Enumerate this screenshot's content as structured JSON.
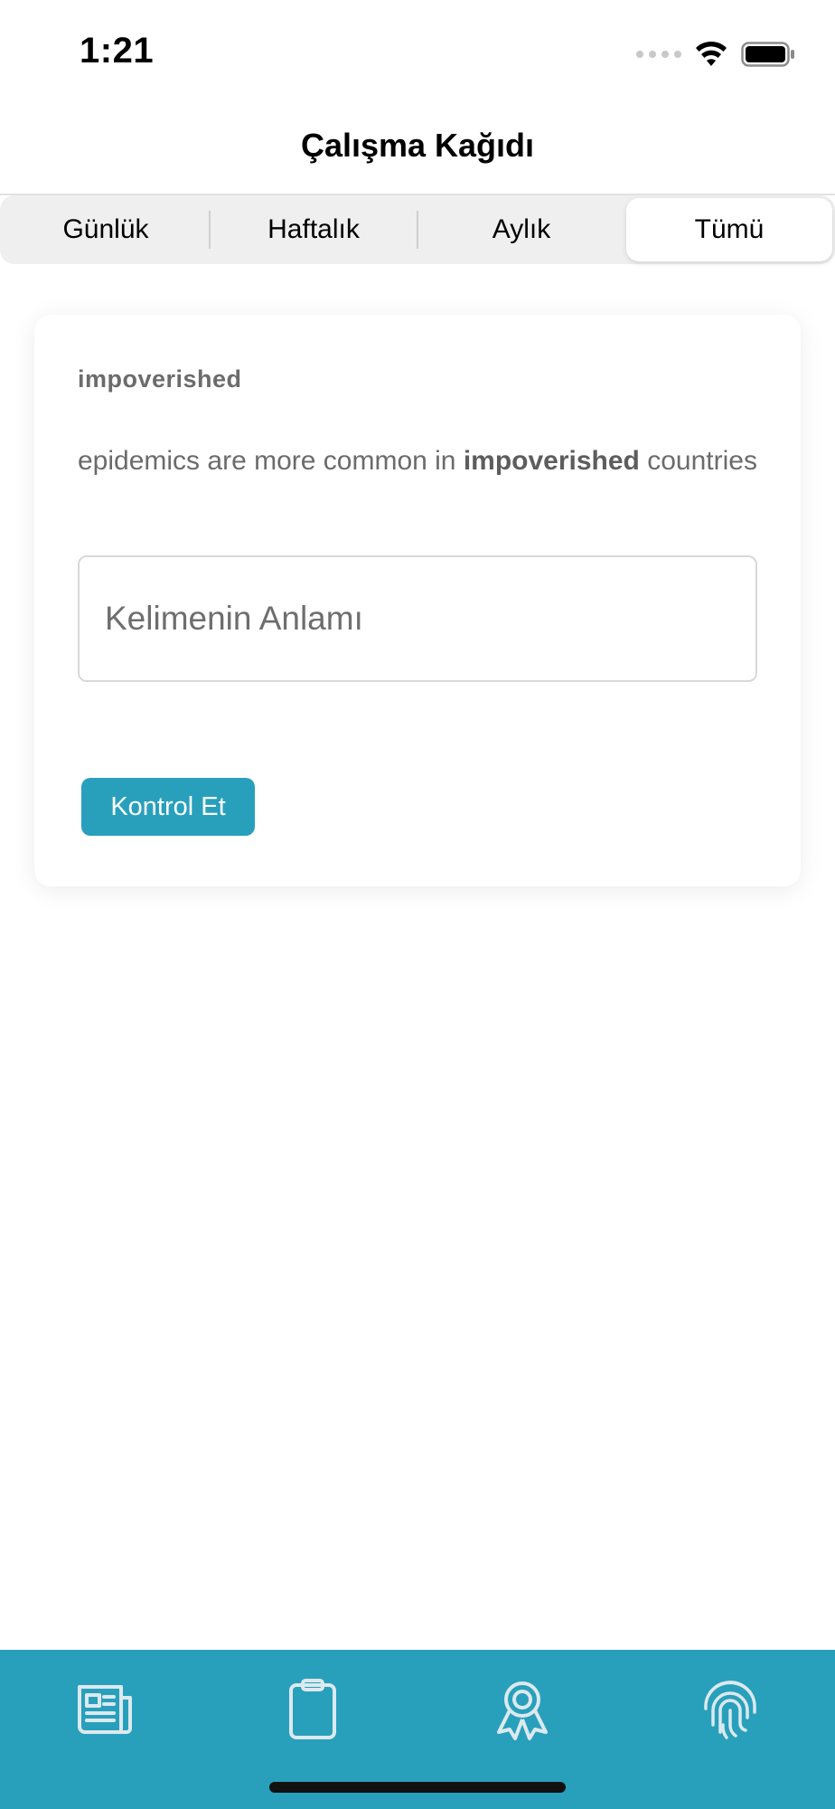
{
  "status_bar": {
    "time": "1:21",
    "icons": [
      "signal-icon",
      "wifi-icon",
      "battery-icon"
    ]
  },
  "nav": {
    "title": "Çalışma Kağıdı"
  },
  "segments": [
    {
      "label": "Günlük",
      "active": false
    },
    {
      "label": "Haftalık",
      "active": false
    },
    {
      "label": "Aylık",
      "active": false
    },
    {
      "label": "Tümü",
      "active": true
    }
  ],
  "card": {
    "word": "impoverished",
    "sentence_before": "epidemics are more common in ",
    "sentence_highlight": "impoverished",
    "sentence_after": " countries",
    "input_value": "",
    "input_placeholder": "Kelimenin Anlamı",
    "check_button_label": "Kontrol Et"
  },
  "tab_bar": {
    "items": [
      "newspaper-icon",
      "clipboard-icon",
      "award-icon",
      "fingerprint-icon"
    ]
  },
  "colors": {
    "accent": "#28a0bc",
    "text_muted": "#6b6b6b",
    "segment_bg": "#efefef"
  }
}
